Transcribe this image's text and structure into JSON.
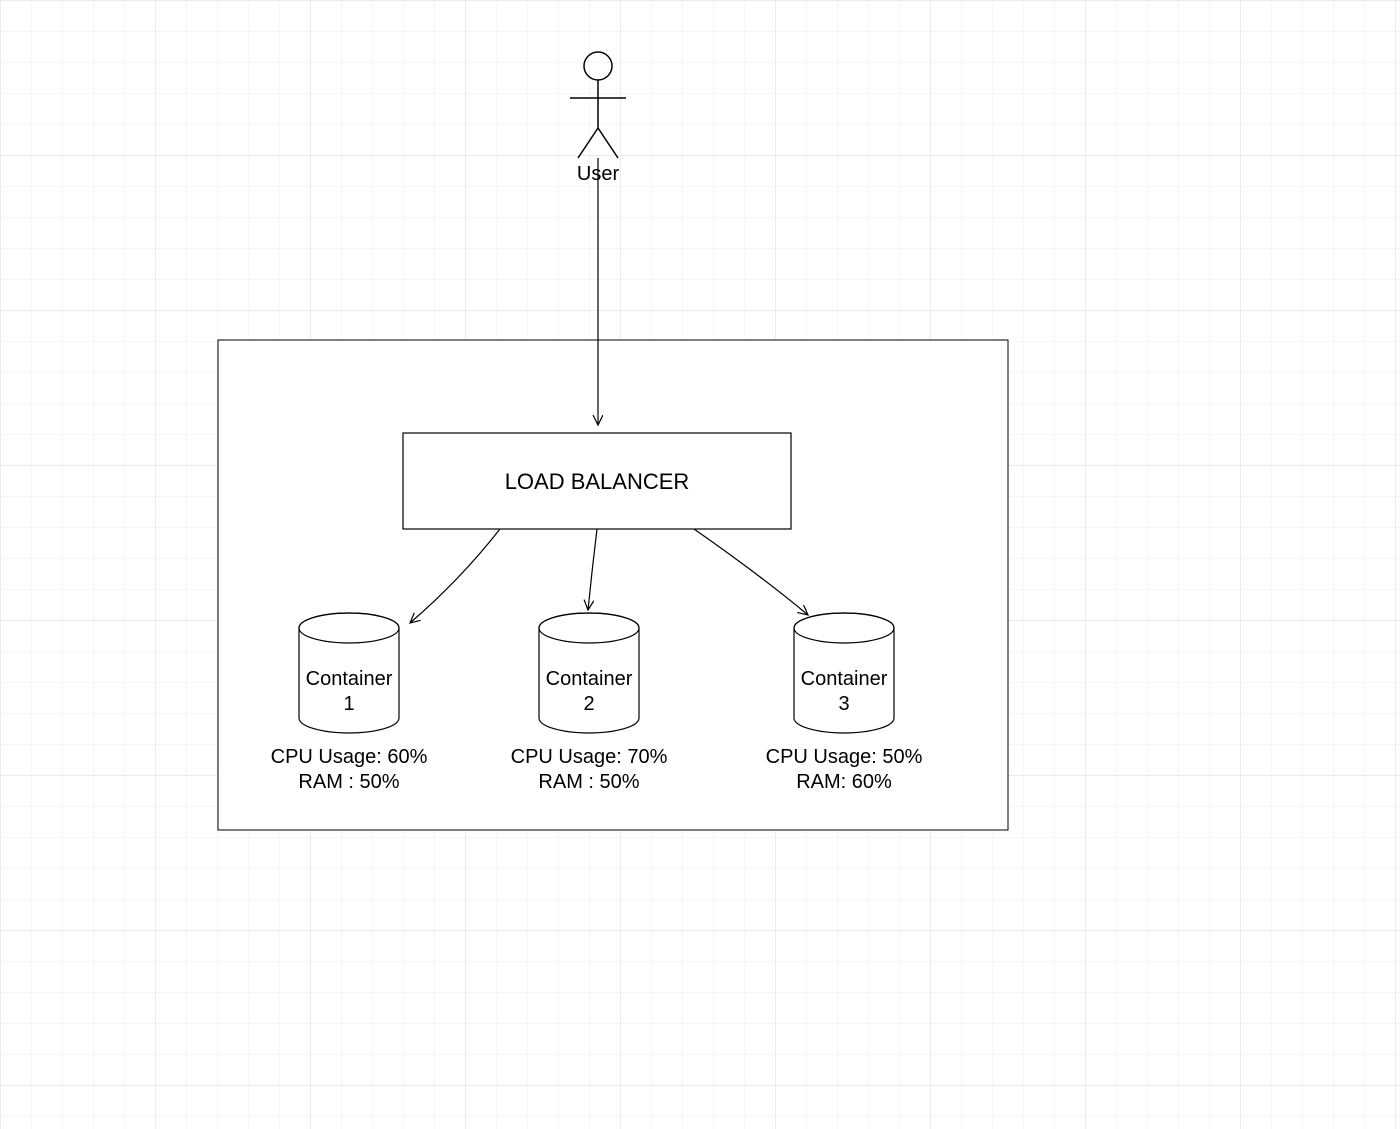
{
  "actor": {
    "label": "User"
  },
  "system_boundary": {},
  "load_balancer": {
    "label": "LOAD BALANCER"
  },
  "containers": [
    {
      "name_line1": "Container",
      "name_line2": "1",
      "cpu_line": "CPU Usage: 60%",
      "ram_line": "RAM : 50%"
    },
    {
      "name_line1": "Container",
      "name_line2": "2",
      "cpu_line": "CPU Usage: 70%",
      "ram_line": "RAM : 50%"
    },
    {
      "name_line1": "Container",
      "name_line2": "3",
      "cpu_line": "CPU Usage: 50%",
      "ram_line": "RAM: 60%"
    }
  ]
}
